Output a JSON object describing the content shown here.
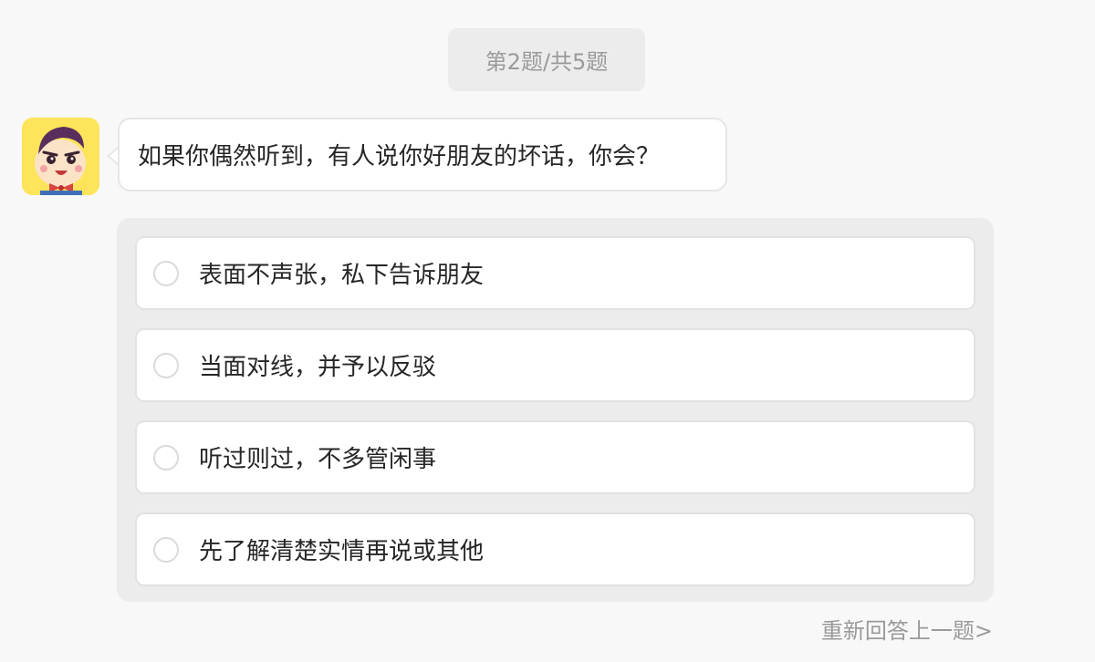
{
  "progress": {
    "label": "第2题/共5题"
  },
  "question": {
    "avatar_icon": "cartoon-boy-avatar",
    "text": "如果你偶然听到，有人说你好朋友的坏话，你会？"
  },
  "options": [
    {
      "label": "表面不声张，私下告诉朋友"
    },
    {
      "label": "当面对线，并予以反驳"
    },
    {
      "label": "听过则过，不多管闲事"
    },
    {
      "label": "先了解清楚实情再说或其他"
    }
  ],
  "footer": {
    "redo_label": "重新回答上一题>"
  },
  "colors": {
    "background": "#f8f8f8",
    "panel": "#ececec",
    "avatar_bg": "#fde45a"
  }
}
